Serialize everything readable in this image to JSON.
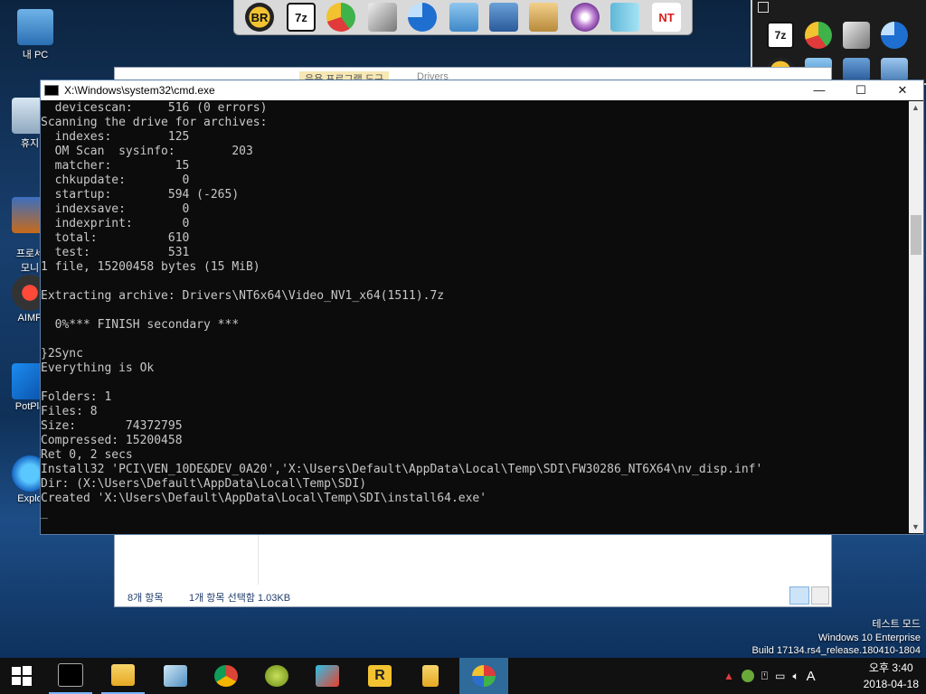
{
  "desktop": {
    "icons": [
      {
        "label": "내 PC",
        "icon": "computer-icon"
      },
      {
        "label": "휴지",
        "icon": "recycle-bin-icon"
      },
      {
        "label": "프로세\n모니",
        "icon": "process-monitor-icon"
      },
      {
        "label": "AIMP",
        "icon": "aimp-icon"
      },
      {
        "label": "PotPla",
        "icon": "potplayer-icon"
      },
      {
        "label": "Explo",
        "icon": "internet-explorer-icon"
      }
    ]
  },
  "quickbar": {
    "items": [
      {
        "label": "BR",
        "icon": "bootice-icon"
      },
      {
        "label": "7z",
        "icon": "7zip-icon"
      },
      {
        "label": "",
        "icon": "partition-icon"
      },
      {
        "label": "",
        "icon": "eraser-icon"
      },
      {
        "label": "",
        "icon": "disk-pie-icon"
      },
      {
        "label": "",
        "icon": "registry-icon"
      },
      {
        "label": "",
        "icon": "network-icon"
      },
      {
        "label": "",
        "icon": "printer-icon"
      },
      {
        "label": "",
        "icon": "dvd-icon"
      },
      {
        "label": "",
        "icon": "book-icon"
      },
      {
        "label": "NT",
        "icon": "ntpwedit-icon"
      }
    ]
  },
  "explorer": {
    "ribbon_tab": "응용 프로그램 도구",
    "title": "Drivers",
    "status_count": "8개 항목",
    "status_selected": "1개 항목 선택함 1.03KB"
  },
  "cmd": {
    "title": "X:\\Windows\\system32\\cmd.exe",
    "minimize": "—",
    "maximize": "☐",
    "close": "✕",
    "lines": [
      "  devicescan:     516 (0 errors)",
      "Scanning the drive for archives:",
      "  indexes:        125",
      "  OM Scan  sysinfo:        203",
      "  matcher:         15",
      "  chkupdate:        0",
      "  startup:        594 (-265)",
      "  indexsave:        0",
      "  indexprint:       0",
      "  total:          610",
      "  test:           531",
      "1 file, 15200458 bytes (15 MiB)",
      "",
      "Extracting archive: Drivers\\NT6x64\\Video_NV1_x64(1511).7z",
      "",
      "  0%*** FINISH secondary ***",
      "",
      "}2Sync",
      "Everything is Ok",
      "",
      "Folders: 1",
      "Files: 8",
      "Size:       74372795",
      "Compressed: 15200458",
      "Ret 0, 2 secs",
      "Install32 'PCI\\VEN_10DE&DEV_0A20','X:\\Users\\Default\\AppData\\Local\\Temp\\SDI\\FW30286_NT6X64\\nv_disp.inf'",
      "Dir: (X:\\Users\\Default\\AppData\\Local\\Temp\\SDI)",
      "Created 'X:\\Users\\Default\\AppData\\Local\\Temp\\SDI\\install64.exe'"
    ],
    "cursor": "_"
  },
  "watermark": {
    "line1": "테스트 모드",
    "line2": "Windows 10 Enterprise",
    "line3": "Build 17134.rs4_release.180410-1804"
  },
  "taskbar": {
    "items": [
      {
        "icon": "start-icon"
      },
      {
        "icon": "cmd-icon"
      },
      {
        "icon": "file-explorer-icon"
      },
      {
        "icon": "notepad-icon"
      },
      {
        "icon": "chrome-icon"
      },
      {
        "icon": "olive-icon"
      },
      {
        "icon": "image-editor-icon"
      },
      {
        "icon": "r-app-icon"
      },
      {
        "icon": "folder-icon"
      },
      {
        "icon": "sdi-icon"
      }
    ],
    "tray_ime": "A",
    "clock_time": "오후 3:40",
    "clock_date": "2018-04-18"
  },
  "colors": {
    "console_bg": "#0c0c0c",
    "console_fg": "#c8c8c8",
    "taskbar_bg": "#111111"
  }
}
